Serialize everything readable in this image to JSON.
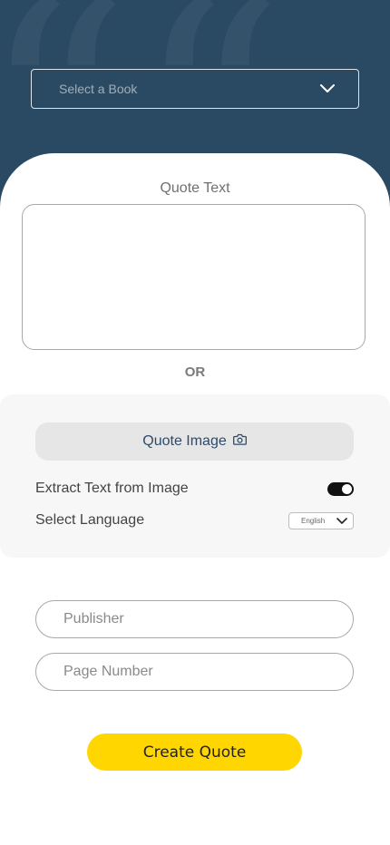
{
  "header": {
    "book_select": {
      "label": "Select a Book",
      "icon": "chevron-down-icon"
    }
  },
  "quote": {
    "label": "Quote Text",
    "value": ""
  },
  "separator": "OR",
  "image_section": {
    "button_label": "Quote Image",
    "button_icon": "camera-icon",
    "extract_label": "Extract Text from Image",
    "extract_enabled": true,
    "language_label": "Select Language",
    "language_value": "English"
  },
  "fields": {
    "publisher_placeholder": "Publisher",
    "page_number_placeholder": "Page Number"
  },
  "actions": {
    "create_label": "Create Quote"
  },
  "colors": {
    "header_bg": "#2a4a63",
    "accent": "#ffd600",
    "toggle_on": "#111111",
    "image_button_text": "#2c4a6a"
  }
}
